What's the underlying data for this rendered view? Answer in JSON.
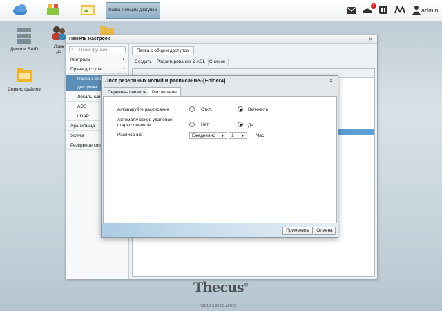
{
  "taskbar": {
    "active_app_label": "Папка с общим доступом",
    "notification_count": "7",
    "user": "admin"
  },
  "desktop": {
    "icons": [
      {
        "label": "Диски и RAID"
      },
      {
        "label": "Лока"
      },
      {
        "label": "до"
      },
      {
        "label": "Сервис файлов"
      }
    ]
  },
  "control_panel": {
    "title": "Панель настроек",
    "search_placeholder": "Поиск функций",
    "sidebar": [
      {
        "label": "Контроль",
        "arrow": "▸"
      },
      {
        "label": "Права доступа",
        "arrow": "▾"
      },
      {
        "label": "Папка с общ"
      },
      {
        "label": "доступом"
      },
      {
        "label": "Локальный"
      },
      {
        "label": "ADS"
      },
      {
        "label": "LDAP"
      },
      {
        "label": "Хранилища"
      },
      {
        "label": "Услуга"
      },
      {
        "label": "Резервное коп"
      }
    ],
    "tab": "Папка с общим доступом",
    "toolbar": [
      "Создать",
      "Редактирование & ACL",
      "Снимок"
    ]
  },
  "dialog": {
    "title": "Лист резервных копий и расписание--[Folder4]",
    "close": "×",
    "tabs": [
      {
        "label": "Перечень снимков",
        "active": false
      },
      {
        "label": "Расписание",
        "active": true
      }
    ],
    "rows": {
      "activate": {
        "label": "Активируйте расписание",
        "option_off": "Откл.",
        "option_on": "Включить",
        "selected": "on"
      },
      "auto_delete": {
        "label": "Автоматическое удаление старых снимков",
        "option_no": "Нет",
        "option_yes": "Да",
        "selected": "yes"
      },
      "schedule": {
        "label": "Расписание",
        "frequency": "Ежедневно",
        "hour": "1",
        "unit": "Час"
      }
    },
    "apply_button": "Применить",
    "cancel_button": "Отмена"
  },
  "branding": {
    "logo": "Thecus",
    "version": "N2810   3.00.03.a2810"
  },
  "colors": {
    "accent": "#5c8fb8",
    "selection_row": "#5c9fd3",
    "badge": "#d7221f"
  }
}
